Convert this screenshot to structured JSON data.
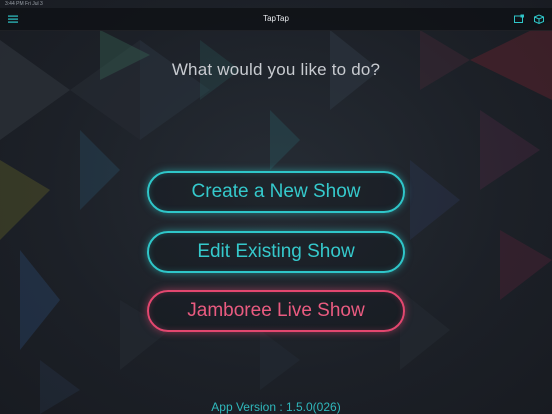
{
  "app": {
    "title": "TapTap"
  },
  "status_bar": {
    "left_text": "3:44 PM  Fri Jul 3"
  },
  "nav": {
    "menu_icon": "hamburger-menu-icon",
    "right_icons": [
      "screen-mirror-icon",
      "box-icon"
    ]
  },
  "main": {
    "prompt": "What would you like to do?",
    "buttons": [
      {
        "label": "Create a New Show",
        "color": "#2fc6c9"
      },
      {
        "label": "Edit Existing Show",
        "color": "#2fc6c9"
      },
      {
        "label": "Jamboree Live Show",
        "color": "#e3476f"
      }
    ]
  },
  "footer": {
    "version": "App Version : 1.5.0(026)"
  },
  "colors": {
    "accent_teal": "#2fc6c9",
    "accent_pink": "#e3476f",
    "background": "#1d2229"
  }
}
